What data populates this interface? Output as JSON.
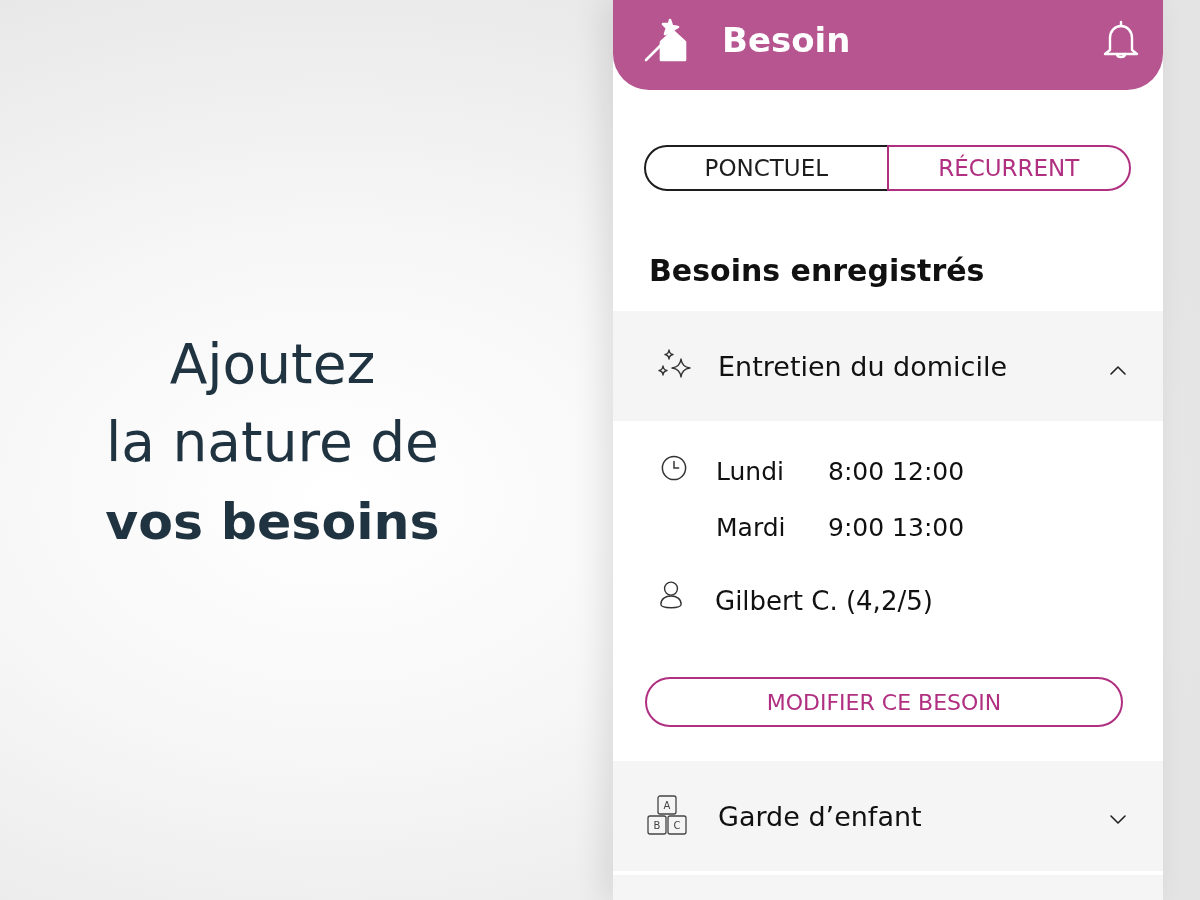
{
  "headline": {
    "lines": [
      "Ajoutez",
      "la nature de",
      "**vos besoins**"
    ]
  },
  "header": {
    "title": "Besoin"
  },
  "mode_tabs": [
    {
      "label": "PONCTUEL",
      "selected": false
    },
    {
      "label": "RÉCURRENT",
      "selected": true
    }
  ],
  "section_title": "Besoins enregistrés",
  "needs": [
    {
      "kind": "cleaning",
      "title": "Entretien du domicile",
      "expanded": true,
      "schedule": [
        {
          "day": "Lundi",
          "hours": "8:00 12:00"
        },
        {
          "day": "Mardi",
          "hours": "9:00 13:00"
        }
      ],
      "provider": "Gilbert C. (4,2/5)",
      "action": "MODIFIER CE BESOIN"
    },
    {
      "kind": "childcare",
      "title": "Garde d’enfant",
      "expanded": false,
      "icon_letters": [
        "A",
        "B",
        "C"
      ]
    }
  ]
}
